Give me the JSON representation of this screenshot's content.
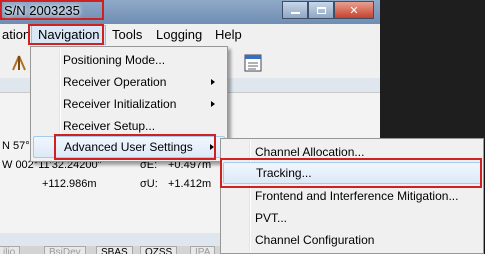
{
  "window": {
    "title": "S/N 2003235"
  },
  "menubar": {
    "items": [
      "ation",
      "Navigation",
      "Tools",
      "Logging",
      "Help"
    ]
  },
  "panel": {
    "lat": "N 57°",
    "lon": "W 002°11'32.24200\"",
    "r1_mid": "σE:",
    "r1_right": "+0.497m",
    "r2_left": "+112.986m",
    "r2_mid": "σU:",
    "r2_right": "+1.412m"
  },
  "tabs": [
    "ilio",
    "BsiDev",
    "SBAS",
    "QZSS",
    "IPA"
  ],
  "nav_menu": {
    "items": [
      "Positioning Mode...",
      "Receiver Operation",
      "Receiver Initialization",
      "Receiver Setup...",
      "Advanced User Settings"
    ]
  },
  "submenu": {
    "items": [
      "Channel Allocation...",
      "Tracking...",
      "Frontend and Interference Mitigation...",
      "PVT...",
      "Channel Configuration"
    ]
  },
  "colors": {
    "highlight_box": "#d02020",
    "menu_bg": "#f0f0f0",
    "desktop": "#1e1e1e"
  }
}
